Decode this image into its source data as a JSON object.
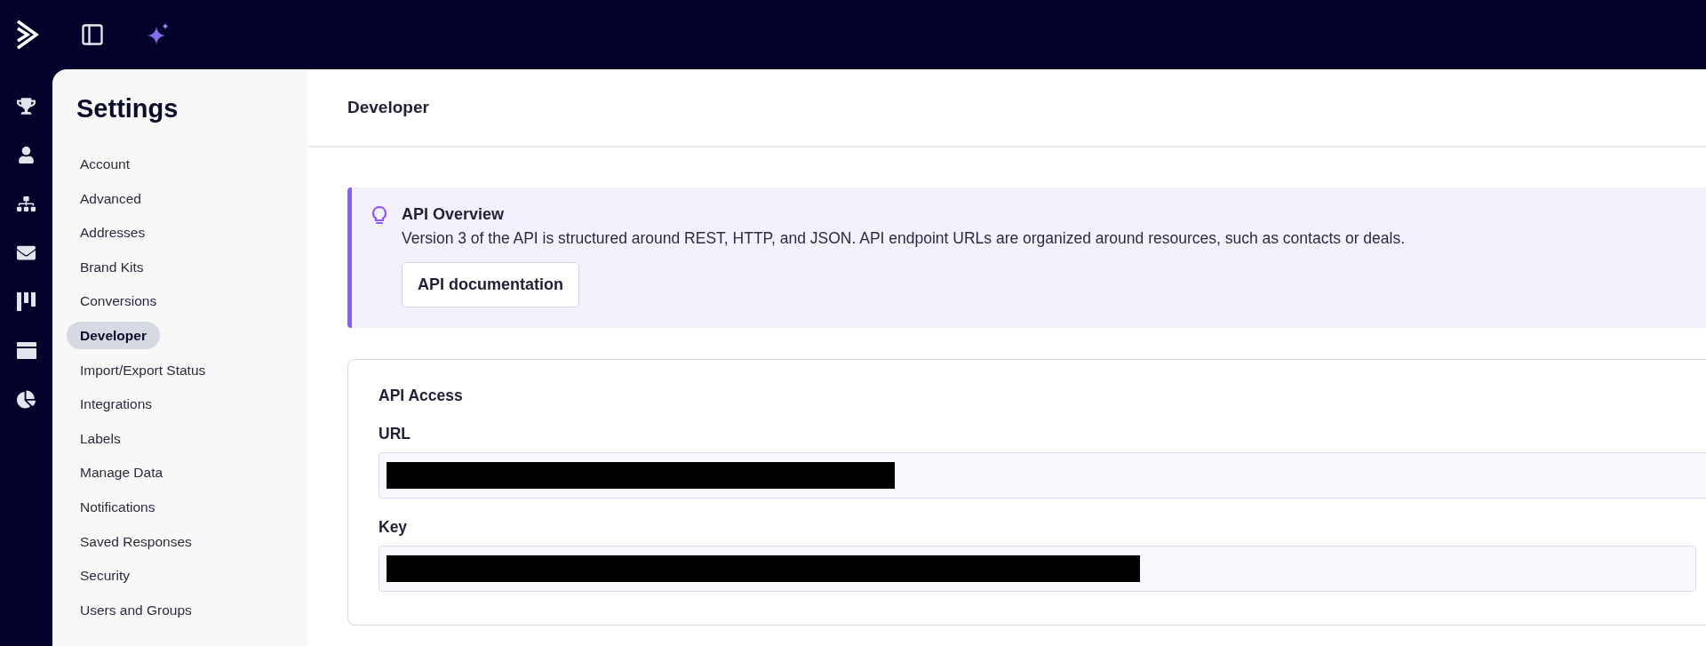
{
  "sidebar": {
    "title": "Settings",
    "items": [
      {
        "label": "Account",
        "selected": false
      },
      {
        "label": "Advanced",
        "selected": false
      },
      {
        "label": "Addresses",
        "selected": false
      },
      {
        "label": "Brand Kits",
        "selected": false
      },
      {
        "label": "Conversions",
        "selected": false
      },
      {
        "label": "Developer",
        "selected": true
      },
      {
        "label": "Import/Export Status",
        "selected": false
      },
      {
        "label": "Integrations",
        "selected": false
      },
      {
        "label": "Labels",
        "selected": false
      },
      {
        "label": "Manage Data",
        "selected": false
      },
      {
        "label": "Notifications",
        "selected": false
      },
      {
        "label": "Saved Responses",
        "selected": false
      },
      {
        "label": "Security",
        "selected": false
      },
      {
        "label": "Users and Groups",
        "selected": false
      }
    ]
  },
  "page": {
    "title": "Developer"
  },
  "banner": {
    "title": "API Overview",
    "text": "Version 3 of the API is structured around REST, HTTP, and JSON. API endpoint URLs are organized around resources, such as contacts or deals.",
    "button": "API documentation"
  },
  "api_access": {
    "title": "API Access",
    "fields": [
      {
        "label": "URL",
        "redacted": true
      },
      {
        "label": "Key",
        "redacted": true
      }
    ]
  }
}
